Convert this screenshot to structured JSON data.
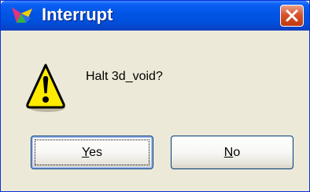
{
  "dialog": {
    "title": "Interrupt",
    "message": "Halt 3d_void?",
    "title_icon": "app-icon",
    "message_icon": "warning-icon",
    "close_icon": "close-icon"
  },
  "buttons": {
    "yes": {
      "mnemonic": "Y",
      "rest": "es"
    },
    "no": {
      "mnemonic": "N",
      "rest": "o"
    }
  },
  "colors": {
    "titlebar": "#0054e3",
    "window_bg": "#ece9d8",
    "close_button": "#d8542d",
    "warning_yellow": "#ffea00"
  }
}
